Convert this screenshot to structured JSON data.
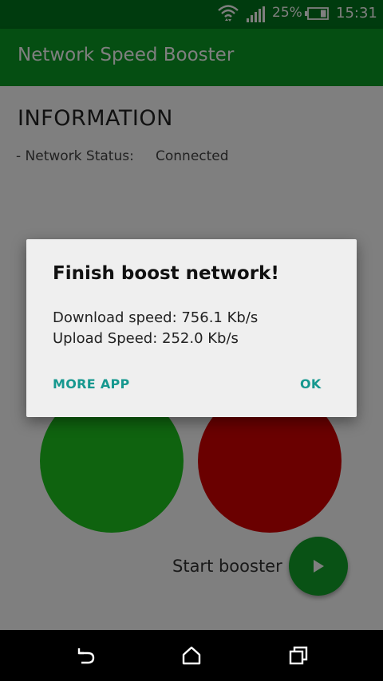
{
  "status_bar": {
    "battery_percent": "25%",
    "time": "15:31",
    "icons": [
      "wifi-icon",
      "signal-icon",
      "battery-icon"
    ]
  },
  "app_bar": {
    "title": "Network Speed Booster"
  },
  "info": {
    "heading": "INFORMATION",
    "status_label": "- Network Status:",
    "status_value": "Connected"
  },
  "booster": {
    "start_label": "Start booster",
    "fab_icon": "play-icon"
  },
  "dialog": {
    "title": "Finish boost network!",
    "download_line": "Download speed: 756.1 Kb/s",
    "upload_line": "Upload Speed: 252.0 Kb/s",
    "more_app_label": "MORE APP",
    "ok_label": "OK"
  },
  "nav_bar": {
    "icons": [
      "back-icon",
      "home-icon",
      "recent-apps-icon"
    ]
  },
  "colors": {
    "status_bar": "#00761c",
    "app_bar": "#0a9d25",
    "green_gauge": "#1fc61f",
    "red_gauge": "#d40000",
    "dialog_button": "#16988f",
    "fab": "#13a52a"
  }
}
